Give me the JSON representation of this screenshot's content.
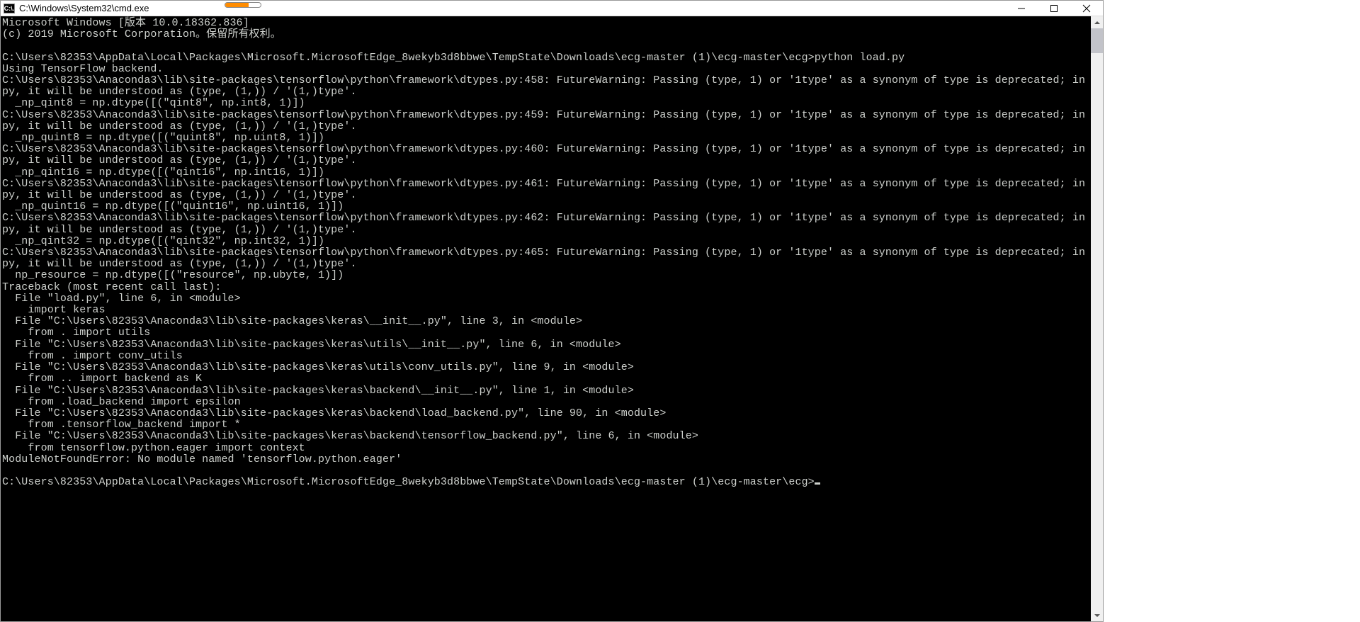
{
  "window": {
    "icon_text": "C:\\.",
    "title": "C:\\Windows\\System32\\cmd.exe"
  },
  "terminal": {
    "lines": [
      "Microsoft Windows [版本 10.0.18362.836]",
      "(c) 2019 Microsoft Corporation。保留所有权利。",
      "",
      "C:\\Users\\82353\\AppData\\Local\\Packages\\Microsoft.MicrosoftEdge_8wekyb3d8bbwe\\TempState\\Downloads\\ecg-master (1)\\ecg-master\\ecg>python load.py",
      "Using TensorFlow backend.",
      "C:\\Users\\82353\\Anaconda3\\lib\\site-packages\\tensorflow\\python\\framework\\dtypes.py:458: FutureWarning: Passing (type, 1) or '1type' as a synonym of type is deprecated; in a future version of numpy, it will be understood as (type, (1,)) / '(1,)type'.",
      "  _np_qint8 = np.dtype([(\"qint8\", np.int8, 1)])",
      "C:\\Users\\82353\\Anaconda3\\lib\\site-packages\\tensorflow\\python\\framework\\dtypes.py:459: FutureWarning: Passing (type, 1) or '1type' as a synonym of type is deprecated; in a future version of numpy, it will be understood as (type, (1,)) / '(1,)type'.",
      "  _np_quint8 = np.dtype([(\"quint8\", np.uint8, 1)])",
      "C:\\Users\\82353\\Anaconda3\\lib\\site-packages\\tensorflow\\python\\framework\\dtypes.py:460: FutureWarning: Passing (type, 1) or '1type' as a synonym of type is deprecated; in a future version of numpy, it will be understood as (type, (1,)) / '(1,)type'.",
      "  _np_qint16 = np.dtype([(\"qint16\", np.int16, 1)])",
      "C:\\Users\\82353\\Anaconda3\\lib\\site-packages\\tensorflow\\python\\framework\\dtypes.py:461: FutureWarning: Passing (type, 1) or '1type' as a synonym of type is deprecated; in a future version of numpy, it will be understood as (type, (1,)) / '(1,)type'.",
      "  _np_quint16 = np.dtype([(\"quint16\", np.uint16, 1)])",
      "C:\\Users\\82353\\Anaconda3\\lib\\site-packages\\tensorflow\\python\\framework\\dtypes.py:462: FutureWarning: Passing (type, 1) or '1type' as a synonym of type is deprecated; in a future version of numpy, it will be understood as (type, (1,)) / '(1,)type'.",
      "  _np_qint32 = np.dtype([(\"qint32\", np.int32, 1)])",
      "C:\\Users\\82353\\Anaconda3\\lib\\site-packages\\tensorflow\\python\\framework\\dtypes.py:465: FutureWarning: Passing (type, 1) or '1type' as a synonym of type is deprecated; in a future version of numpy, it will be understood as (type, (1,)) / '(1,)type'.",
      "  np_resource = np.dtype([(\"resource\", np.ubyte, 1)])",
      "Traceback (most recent call last):",
      "  File \"load.py\", line 6, in <module>",
      "    import keras",
      "  File \"C:\\Users\\82353\\Anaconda3\\lib\\site-packages\\keras\\__init__.py\", line 3, in <module>",
      "    from . import utils",
      "  File \"C:\\Users\\82353\\Anaconda3\\lib\\site-packages\\keras\\utils\\__init__.py\", line 6, in <module>",
      "    from . import conv_utils",
      "  File \"C:\\Users\\82353\\Anaconda3\\lib\\site-packages\\keras\\utils\\conv_utils.py\", line 9, in <module>",
      "    from .. import backend as K",
      "  File \"C:\\Users\\82353\\Anaconda3\\lib\\site-packages\\keras\\backend\\__init__.py\", line 1, in <module>",
      "    from .load_backend import epsilon",
      "  File \"C:\\Users\\82353\\Anaconda3\\lib\\site-packages\\keras\\backend\\load_backend.py\", line 90, in <module>",
      "    from .tensorflow_backend import *",
      "  File \"C:\\Users\\82353\\Anaconda3\\lib\\site-packages\\keras\\backend\\tensorflow_backend.py\", line 6, in <module>",
      "    from tensorflow.python.eager import context",
      "ModuleNotFoundError: No module named 'tensorflow.python.eager'",
      "",
      "C:\\Users\\82353\\AppData\\Local\\Packages\\Microsoft.MicrosoftEdge_8wekyb3d8bbwe\\TempState\\Downloads\\ecg-master (1)\\ecg-master\\ecg>"
    ],
    "wrap_cols": 192
  }
}
